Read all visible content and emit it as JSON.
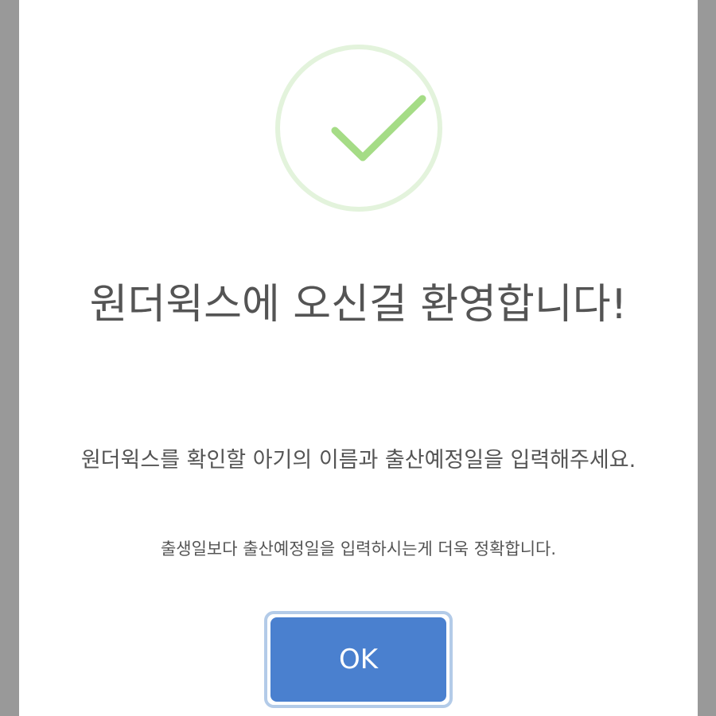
{
  "dialog": {
    "icon": "success-check-icon",
    "title": "원더윅스에 오신걸 환영합니다!",
    "text": "원더윅스를 확인할 아기의 이름과 출산예정일을 입력해주세요.",
    "subtext": "출생일보다 출산예정일을 입력하시는게 더욱 정확합니다.",
    "confirm_label": "OK"
  },
  "colors": {
    "overlay": "#999999",
    "modal_background": "#ffffff",
    "success_ring": "#e3f3dc",
    "success_check": "#a5dc86",
    "text": "#545454",
    "button": "#4a80cf",
    "button_focus_ring": "#b3cbe8"
  }
}
